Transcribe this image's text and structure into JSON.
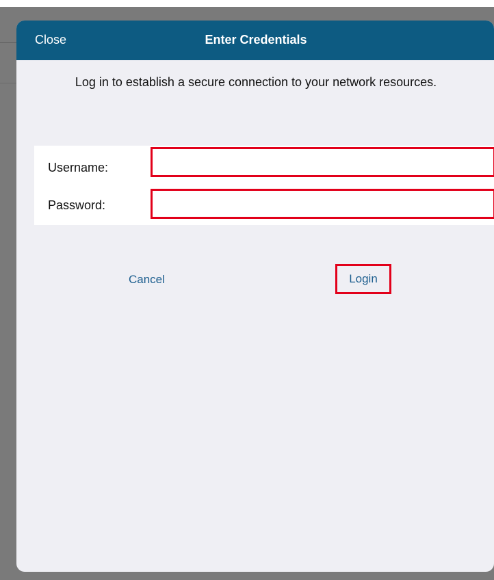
{
  "modal": {
    "close_label": "Close",
    "title": "Enter Credentials",
    "description": "Log in to establish a secure connection to your network resources."
  },
  "form": {
    "username_label": "Username:",
    "username_value": "",
    "password_label": "Password:",
    "password_value": ""
  },
  "actions": {
    "cancel_label": "Cancel",
    "login_label": "Login"
  },
  "colors": {
    "header": "#0d5b82",
    "link": "#1e5f8f",
    "highlight": "#e2001a",
    "background": "#efeff4",
    "backdrop": "#7a7a7a"
  }
}
